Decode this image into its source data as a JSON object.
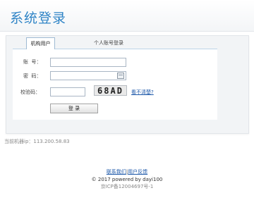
{
  "header": {
    "title": "系统登录"
  },
  "tabs": [
    {
      "label": "机构用户",
      "active": true
    },
    {
      "label": "个人账号登录",
      "active": false
    }
  ],
  "form": {
    "account_label": "账  号：",
    "password_label": "密  码：",
    "captcha_label": "校验码：",
    "account_value": "",
    "password_value": "",
    "captcha_value": "",
    "captcha_image_text": "68AD",
    "refresh_link": "看不清楚?",
    "login_button": "登 录"
  },
  "status": {
    "ip_label": "当前机器ip：",
    "ip_value": "113.200.58.83"
  },
  "footer": {
    "contact_link": "联系我们",
    "separator": "|",
    "feedback_link": "用户反馈",
    "copyright": "© 2017 powered by dayi100",
    "icp": "京ICP备12004697号-1"
  },
  "colors": {
    "title_blue": "#2f84c6",
    "link_blue": "#1a56a8",
    "panel_bg": "#f2f4f6"
  },
  "icons": {
    "calendar": "calendar-icon"
  }
}
